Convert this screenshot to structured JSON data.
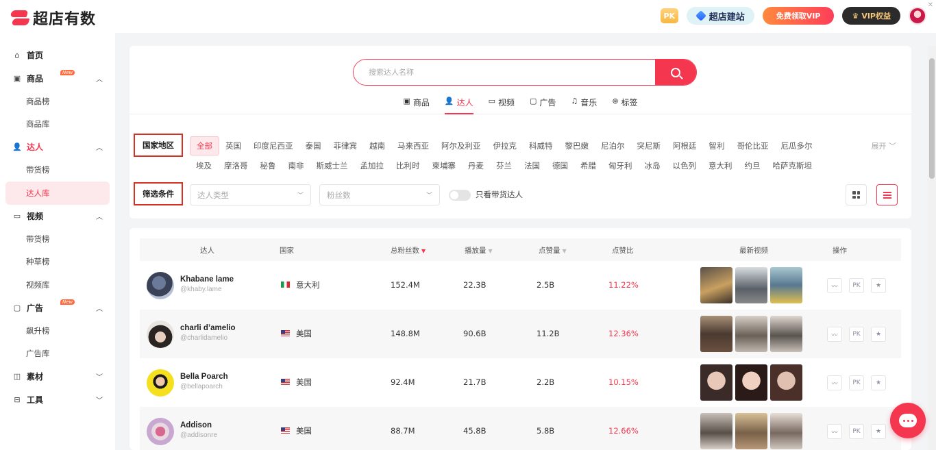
{
  "brand": {
    "name": "超店有数"
  },
  "header": {
    "pk_label": "PK",
    "site_build": "超店建站",
    "vip_free": "免费领取VIP",
    "vip_rights": "VIP权益"
  },
  "sidebar": {
    "home": "首页",
    "goods": {
      "label": "商品",
      "badge": "New",
      "subs": [
        "商品榜",
        "商品库"
      ]
    },
    "influencer": {
      "label": "达人",
      "subs": [
        "带货榜",
        "达人库"
      ]
    },
    "video": {
      "label": "视频",
      "subs": [
        "带货榜",
        "种草榜",
        "视频库"
      ]
    },
    "ads": {
      "label": "广告",
      "badge": "New",
      "subs": [
        "飙升榜",
        "广告库"
      ]
    },
    "material": "素材",
    "tools": "工具"
  },
  "search": {
    "placeholder": "搜索达人名称"
  },
  "tabs": [
    {
      "label": "商品",
      "icon": "bag-icon"
    },
    {
      "label": "达人",
      "icon": "person-icon"
    },
    {
      "label": "视频",
      "icon": "video-icon"
    },
    {
      "label": "广告",
      "icon": "ad-icon"
    },
    {
      "label": "音乐",
      "icon": "music-icon"
    },
    {
      "label": "标签",
      "icon": "tag-icon"
    }
  ],
  "filters": {
    "region_label": "国家地区",
    "condition_label": "筛选条件",
    "countries_row1": [
      "全部",
      "英国",
      "印度尼西亚",
      "泰国",
      "菲律宾",
      "越南",
      "马来西亚",
      "阿尔及利亚",
      "伊拉克",
      "科威特",
      "黎巴嫩",
      "尼泊尔",
      "突尼斯",
      "阿根廷",
      "智利",
      "哥伦比亚",
      "厄瓜多尔"
    ],
    "countries_row2": [
      "埃及",
      "摩洛哥",
      "秘鲁",
      "南非",
      "斯威士兰",
      "孟加拉",
      "比利时",
      "柬埔寨",
      "丹麦",
      "芬兰",
      "法国",
      "德国",
      "希腊",
      "匈牙利",
      "冰岛",
      "以色列",
      "意大利",
      "约旦",
      "哈萨克斯坦"
    ],
    "expand": "展开",
    "type_placeholder": "达人类型",
    "fans_placeholder": "粉丝数",
    "toggle_label": "只看带货达人"
  },
  "table": {
    "headers": {
      "influencer": "达人",
      "country": "国家",
      "fans": "总粉丝数",
      "plays": "播放量",
      "likes": "点赞量",
      "like_rate": "点赞比",
      "latest_videos": "最新视频",
      "actions": "操作"
    },
    "rows": [
      {
        "name": "Khabane lame",
        "handle": "@khaby.lame",
        "country": "意大利",
        "flag": "it",
        "fans": "152.4M",
        "plays": "22.3B",
        "likes": "2.5B",
        "rate": "11.22%"
      },
      {
        "name": "charli d’amelio",
        "handle": "@charlidamelio",
        "country": "美国",
        "flag": "us",
        "fans": "148.8M",
        "plays": "90.6B",
        "likes": "11.2B",
        "rate": "12.36%"
      },
      {
        "name": "Bella Poarch",
        "handle": "@bellapoarch",
        "country": "美国",
        "flag": "us",
        "fans": "92.4M",
        "plays": "21.7B",
        "likes": "2.2B",
        "rate": "10.15%"
      },
      {
        "name": "Addison",
        "handle": "@addisonre",
        "country": "美国",
        "flag": "us",
        "fans": "88.7M",
        "plays": "45.8B",
        "likes": "5.8B",
        "rate": "12.66%"
      }
    ],
    "op_pk": "PK"
  },
  "colors": {
    "accent": "#f5364f"
  }
}
